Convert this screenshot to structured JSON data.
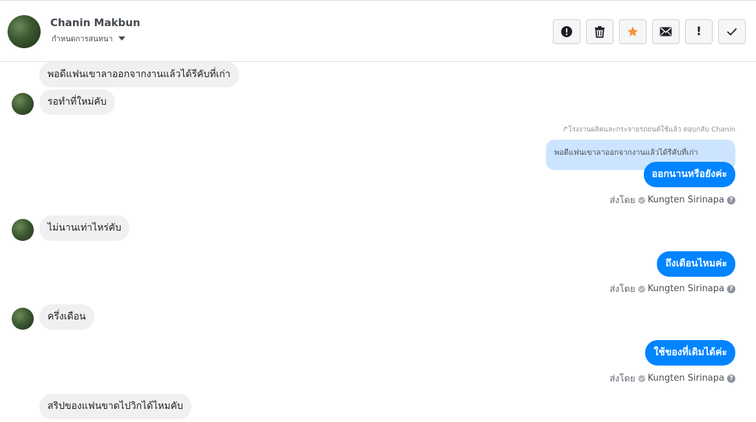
{
  "header": {
    "name": "Chanin Makbun",
    "subtitle": "กำหนดการสนทนา",
    "actions": [
      {
        "name": "alert-icon",
        "color": "#1c1e21"
      },
      {
        "name": "trash-icon",
        "color": "#1c1e21"
      },
      {
        "name": "star-icon",
        "color": "#f7923a"
      },
      {
        "name": "mail-icon",
        "color": "#1c1e21"
      },
      {
        "name": "exclamation-icon",
        "label": "!",
        "color": "#1c1e21"
      },
      {
        "name": "check-icon",
        "color": "#1c1e21"
      }
    ]
  },
  "messages": {
    "in_1": "พอดีแฟนเขาลาออกจากงานแล้วได้รีคับที่เก่า",
    "in_2": "รอทำที่ใหม่คับ",
    "reply_meta": "โรงงานผลิตและกระจายรถยนต์ใช้แล้ว ตอบกลับ Chanin",
    "reply_quote": "พอดีแฟนเขาลาออกจากงานแล้วได้รีคับที่เก่า",
    "out_1": "ออกนานหรือยังค่ะ",
    "in_3": "ไม่นานเท่าไหร่คับ",
    "out_2": "ถึงเดือนไหมค่ะ",
    "in_4": "ครึ่งเดือน",
    "out_3": "ใช้ของที่เดิมได้ค่ะ",
    "in_5": "สริปของแฟนขาดไปวิกได้ไหมคับ"
  },
  "sent_by": {
    "label": "ส่งโดย",
    "name": "Kungten Sirinapa",
    "help": "?"
  },
  "colors": {
    "outgoing_bubble": "#0084ff",
    "incoming_bubble": "#f1f0f0",
    "reply_quote_bg": "#cce4ff"
  }
}
